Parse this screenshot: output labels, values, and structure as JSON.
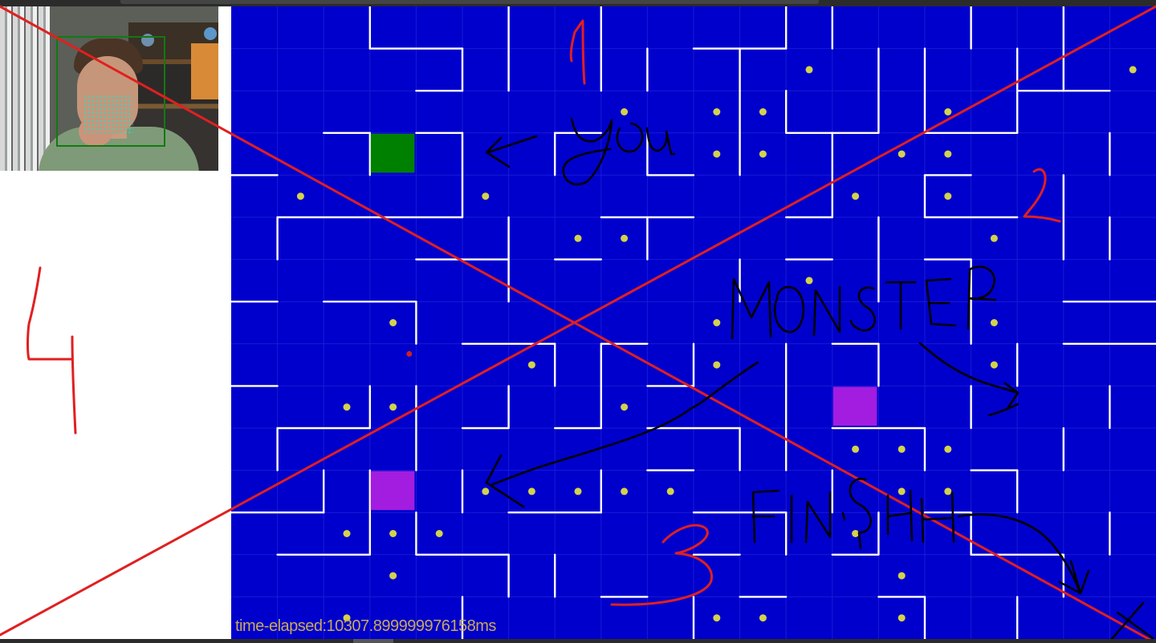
{
  "status": {
    "time_elapsed": "time-elapsed:10307.899999976158ms"
  },
  "colors": {
    "maze_background": "#0000cc",
    "wall": "#ffffff",
    "cell_grid": "#1a1ad6",
    "coin": "#d4d24a",
    "player": "#008000",
    "monster": "#a21de0",
    "red_dot": "#cc2222",
    "annotation_red": "#e02020",
    "annotation_black": "#000000",
    "webcam_face_box": "#117a11"
  },
  "maze": {
    "cols": 15,
    "rows": 15,
    "player": {
      "col": 3,
      "row": 3
    },
    "monsters": [
      {
        "col": 3,
        "row": 11
      },
      {
        "col": 13,
        "row": 9
      }
    ],
    "coins": [
      [
        12,
        1
      ],
      [
        19,
        1
      ],
      [
        8,
        2
      ],
      [
        10,
        2
      ],
      [
        11,
        2
      ],
      [
        15,
        2
      ],
      [
        10,
        3
      ],
      [
        11,
        3
      ],
      [
        14,
        3
      ],
      [
        15,
        3
      ],
      [
        1,
        4
      ],
      [
        5,
        4
      ],
      [
        13,
        4
      ],
      [
        15,
        4
      ],
      [
        7,
        5
      ],
      [
        8,
        5
      ],
      [
        16,
        5
      ],
      [
        12,
        6
      ],
      [
        3,
        7
      ],
      [
        10,
        7
      ],
      [
        16,
        7
      ],
      [
        6,
        8
      ],
      [
        10,
        8
      ],
      [
        16,
        8
      ],
      [
        2,
        9
      ],
      [
        3,
        9
      ],
      [
        8,
        9
      ],
      [
        13,
        10
      ],
      [
        14,
        10
      ],
      [
        15,
        10
      ],
      [
        5,
        11
      ],
      [
        6,
        11
      ],
      [
        7,
        11
      ],
      [
        8,
        11
      ],
      [
        9,
        11
      ],
      [
        14,
        11
      ],
      [
        15,
        11
      ],
      [
        2,
        12
      ],
      [
        3,
        12
      ],
      [
        4,
        12
      ],
      [
        13,
        12
      ],
      [
        3,
        13
      ],
      [
        14,
        13
      ],
      [
        2,
        14
      ],
      [
        10,
        14
      ],
      [
        11,
        14
      ],
      [
        14,
        14
      ]
    ]
  },
  "annotations": {
    "label_you": "you",
    "label_monster": "MONSTER",
    "label_finish": "FINISH",
    "numbers": [
      "1",
      "2",
      "3",
      "4"
    ]
  }
}
